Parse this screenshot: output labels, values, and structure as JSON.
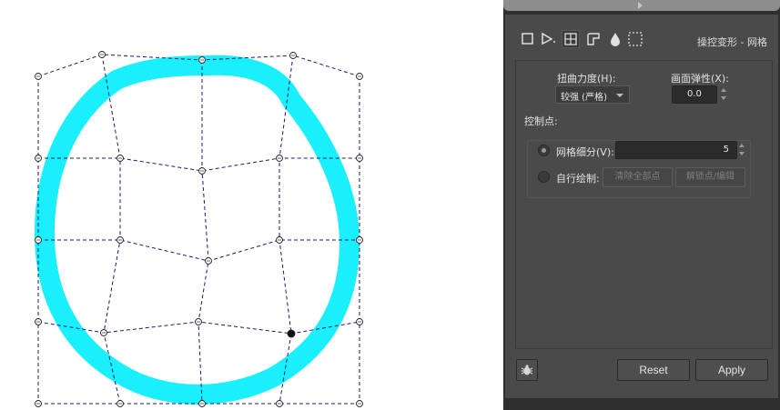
{
  "panel": {
    "title": "操控变形 - 网格",
    "tools": [
      "rectangle-tool-icon",
      "perspective-tool-icon",
      "mesh-warp-tool-icon",
      "envelope-tool-icon",
      "liquify-tool-icon",
      "selection-tool-icon"
    ],
    "distortion_strength": {
      "label": "扭曲力度(H):",
      "value": "较强 (严格)"
    },
    "canvas_elasticity": {
      "label": "画面弹性(X):",
      "value": "0.0"
    },
    "control_points": {
      "label": "控制点:",
      "mesh_subdivision": {
        "label": "网格细分(V):",
        "value": "5",
        "checked": true
      },
      "custom_draw": {
        "label": "自行绘制:",
        "checked": false,
        "clear_all_label": "清除全部点",
        "unlock_edit_label": "解锁点/编辑"
      }
    },
    "buttons": {
      "reset": "Reset",
      "apply": "Apply"
    },
    "debug_icon": "bug-icon"
  },
  "canvas": {
    "ring_color": "#19f0fc",
    "mesh_color": "#1a1a7a"
  }
}
